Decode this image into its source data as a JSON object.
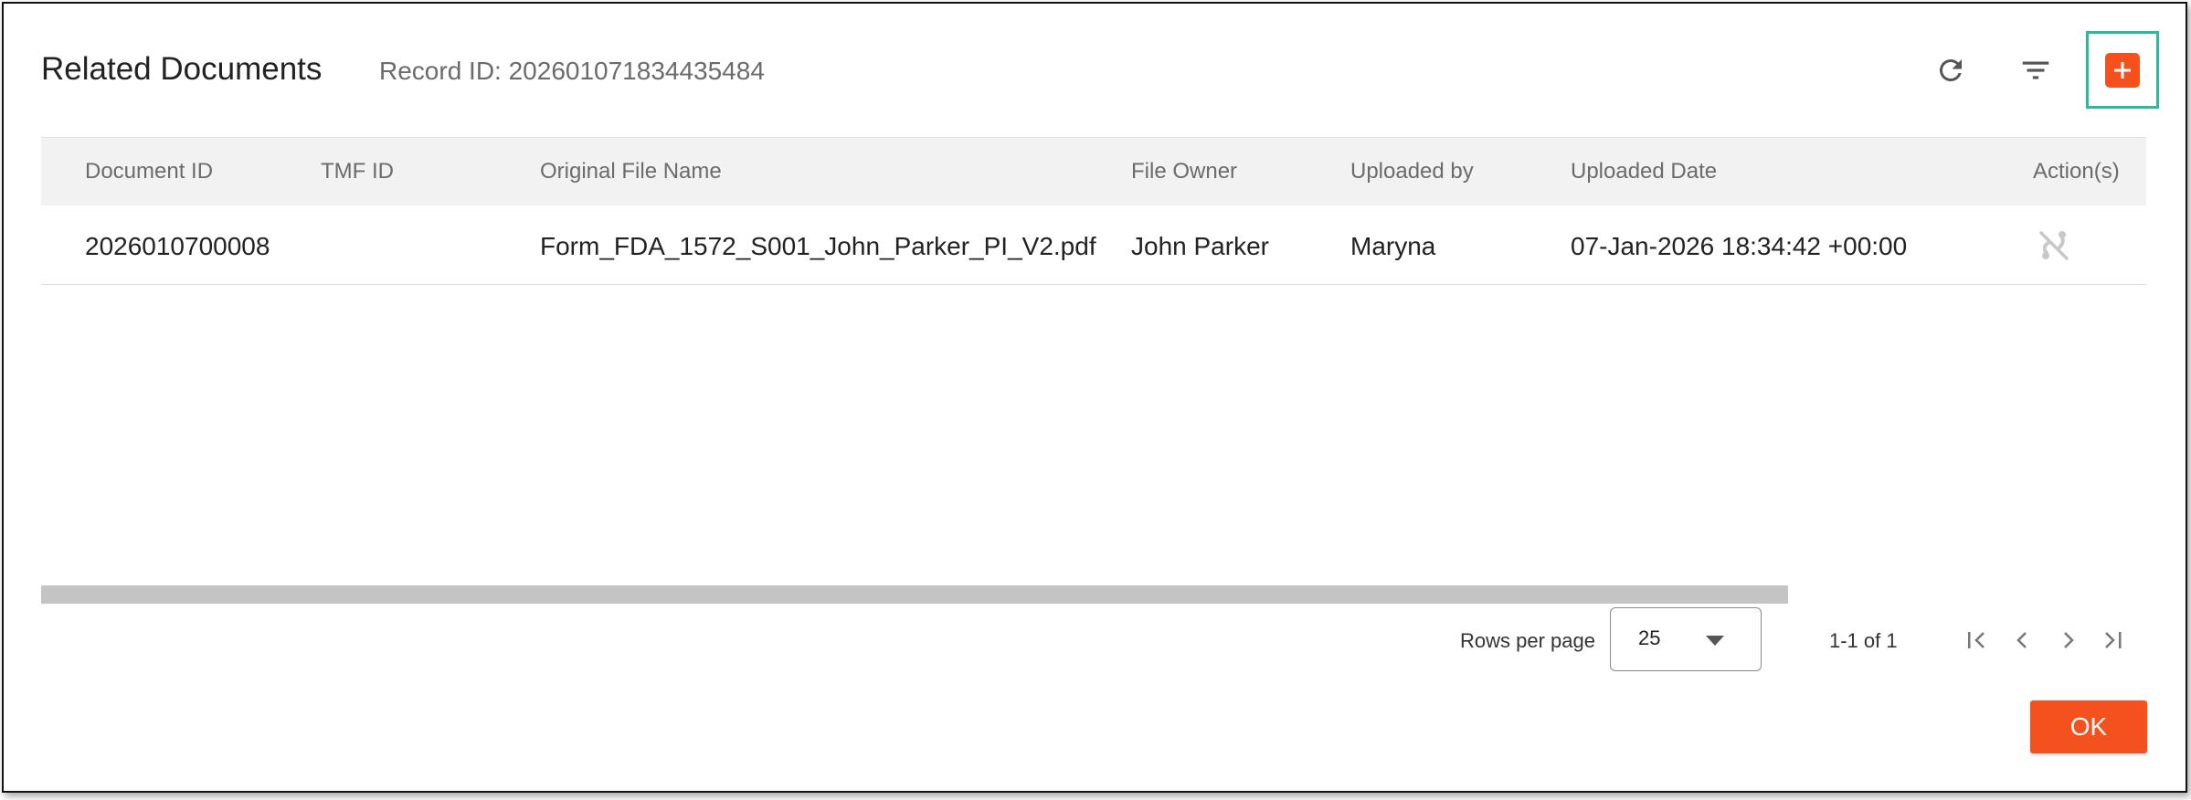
{
  "dialog": {
    "title": "Related Documents",
    "record_id": "Record ID: 202601071834435484"
  },
  "toolbar": {
    "refresh_icon": "refresh-icon",
    "filter_icon": "filter-icon",
    "add_icon": "add-icon",
    "accent_color": "#f4511e",
    "highlight_color": "#2fb89c"
  },
  "table": {
    "columns": [
      "Document ID",
      "TMF ID",
      "Original File Name",
      "File Owner",
      "Uploaded by",
      "Uploaded Date",
      "Action(s)"
    ],
    "rows": [
      {
        "document_id": "2026010700008",
        "tmf_id": "",
        "file_name": "Form_FDA_1572_S001_John_Parker_PI_V2.pdf",
        "file_owner": "John Parker",
        "uploaded_by": "Maryna",
        "uploaded_date": "07-Jan-2026 18:34:42 +00:00",
        "action_icon": "unlink-icon"
      }
    ]
  },
  "pagination": {
    "rows_per_page_label": "Rows per page",
    "rows_per_page_value": "25",
    "range_text": "1-1 of 1"
  },
  "footer": {
    "ok_label": "OK"
  }
}
